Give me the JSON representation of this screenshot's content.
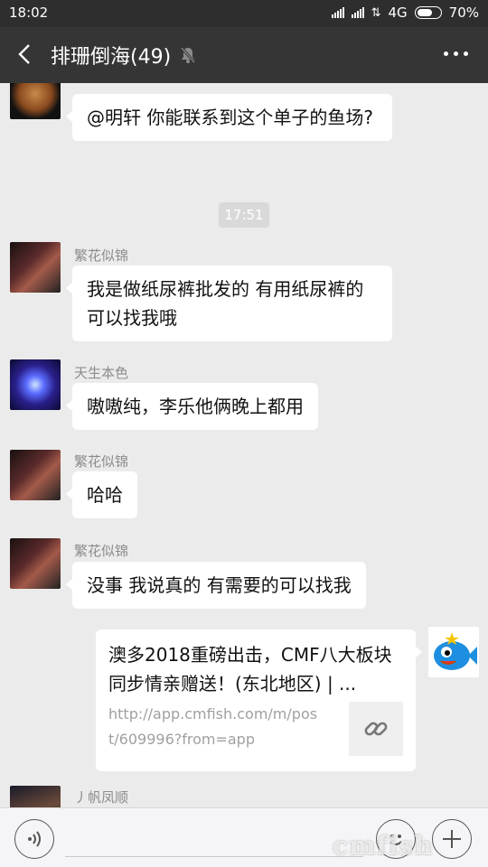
{
  "status": {
    "time": "18:02",
    "network": "4G",
    "battery": "70%"
  },
  "header": {
    "title": "排珊倒海(49)"
  },
  "messages": [
    {
      "name": "",
      "text": "@明轩  你能联系到这个单子的鱼场?"
    },
    {
      "name": "繁花似锦",
      "text": "我是做纸尿裤批发的  有用纸尿裤的可以找我哦"
    },
    {
      "name": "天生本色",
      "text": "嗷嗷纯，李乐他俩晚上都用"
    },
    {
      "name": "繁花似锦",
      "text": "哈哈"
    },
    {
      "name": "繁花似锦",
      "text": "没事  我说真的 有需要的可以找我"
    },
    {
      "name": "丿帆凤顺",
      "text": ""
    }
  ],
  "timestamp": "17:51",
  "link_card": {
    "title": "澳多2018重磅出击，CMF八大板块同步情亲赠送！(东北地区) | ...",
    "url": "http://app.cmfish.com/m/post/609996?from=app"
  },
  "watermark": "cmfish",
  "colors": {
    "titlebar": "#353535",
    "background": "#ebebeb",
    "bubble": "#ffffff"
  }
}
